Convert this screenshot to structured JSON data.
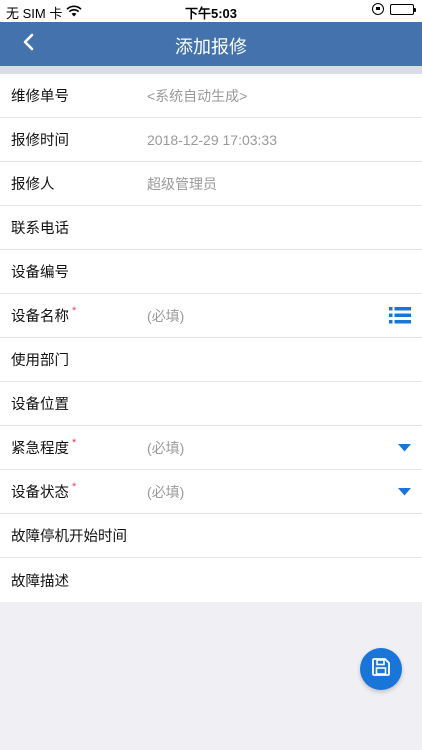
{
  "status_bar": {
    "carrier": "无 SIM 卡",
    "time": "下午5:03",
    "wifi_icon": "wifi-icon",
    "battery_icon": "battery-icon"
  },
  "nav": {
    "back_icon": "chevron-left-icon",
    "title": "添加报修"
  },
  "form": {
    "rows": [
      {
        "label": "维修单号",
        "value": "<系统自动生成>",
        "required": false
      },
      {
        "label": "报修时间",
        "value": "2018-12-29 17:03:33",
        "required": false
      },
      {
        "label": "报修人",
        "value": "超级管理员",
        "required": false
      },
      {
        "label": "联系电话",
        "value": "",
        "required": false
      },
      {
        "label": "设备编号",
        "value": "",
        "required": false
      },
      {
        "label": "设备名称",
        "value": "(必填)",
        "required": true,
        "suffix_icon": "list-icon"
      },
      {
        "label": "使用部门",
        "value": "",
        "required": false
      },
      {
        "label": "设备位置",
        "value": "",
        "required": false
      },
      {
        "label": "紧急程度",
        "value": "(必填)",
        "required": true,
        "suffix_icon": "caret-down-icon"
      },
      {
        "label": "设备状态",
        "value": "(必填)",
        "required": true,
        "suffix_icon": "caret-down-icon"
      },
      {
        "label": "故障停机开始时间",
        "value": "",
        "required": false
      },
      {
        "label": "故障描述",
        "value": "",
        "required": false
      }
    ],
    "required_mark": "*"
  },
  "fab": {
    "icon": "save-icon"
  },
  "colors": {
    "nav_bg": "#4372ad",
    "accent": "#1976d8",
    "required": "#e5404d",
    "placeholder": "#9a9a9a",
    "page_bg": "#efeff4"
  }
}
